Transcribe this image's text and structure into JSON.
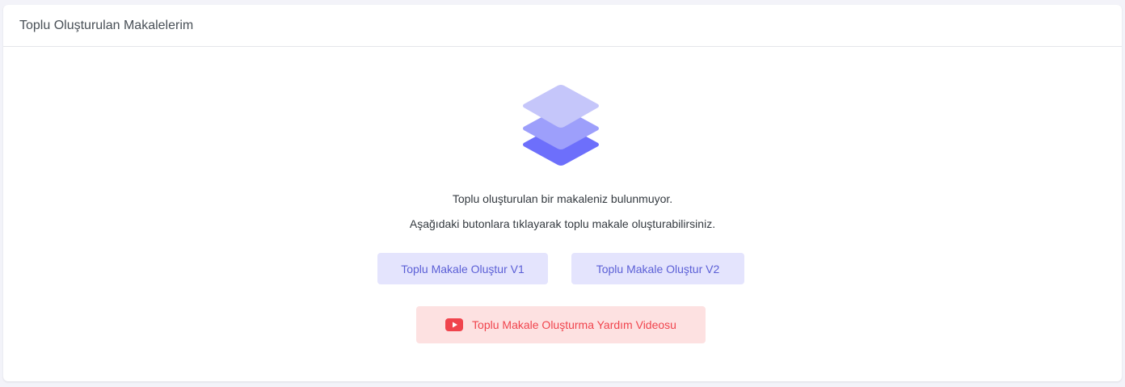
{
  "card": {
    "title": "Toplu Oluşturulan Makalelerim"
  },
  "empty_state": {
    "icon": "layers-icon",
    "line1": "Toplu oluşturulan bir makaleniz bulunmuyor.",
    "line2": "Aşağıdaki butonlara tıklayarak toplu makale oluşturabilirsiniz."
  },
  "actions": {
    "create_v1_label": "Toplu Makale Oluştur V1",
    "create_v2_label": "Toplu Makale Oluştur V2",
    "help_video_label": "Toplu Makale Oluşturma Yardım Videosu",
    "help_video_icon": "youtube-icon"
  },
  "colors": {
    "primary_soft_bg": "#e4e4fd",
    "primary_text": "#5b5fd6",
    "danger_soft_bg": "#fde1e1",
    "danger_text": "#f0444d",
    "layer_top": "#c5c6fa",
    "layer_mid": "#9d9ffb",
    "layer_bottom": "#6d6ffb"
  }
}
